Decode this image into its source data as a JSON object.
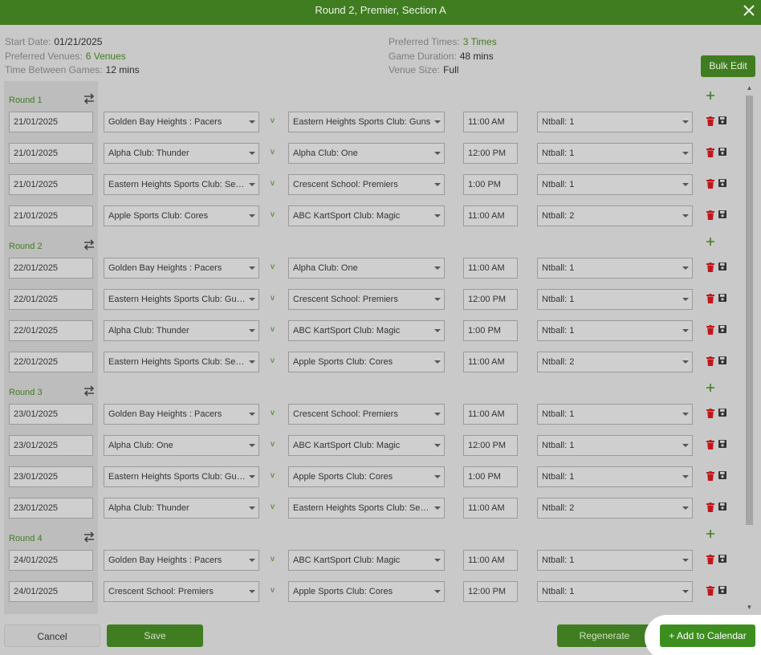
{
  "titlebar": {
    "title": "Round 2, Premier, Section A",
    "close_icon": "close-icon"
  },
  "info": {
    "start_date_label": "Start Date:",
    "start_date": "01/21/2025",
    "preferred_venues_label": "Preferred Venues:",
    "preferred_venues": "6 Venues",
    "time_between_label": "Time Between Games:",
    "time_between": "12 mins",
    "preferred_times_label": "Preferred Times:",
    "preferred_times": "3 Times",
    "game_duration_label": "Game Duration:",
    "game_duration": "48 mins",
    "venue_size_label": "Venue Size:",
    "venue_size": "Full"
  },
  "bulk_edit_label": "Bulk Edit",
  "vs_label": "v",
  "rounds": [
    {
      "label": "Round 1",
      "matches": [
        {
          "date": "21/01/2025",
          "home": "Golden Bay Heights : Pacers",
          "away": "Eastern Heights Sports Club: Guns",
          "time": "11:00 AM",
          "venue": "Ntball: 1"
        },
        {
          "date": "21/01/2025",
          "home": "Alpha Club: Thunder",
          "away": "Alpha Club: One",
          "time": "12:00 PM",
          "venue": "Ntball: 1"
        },
        {
          "date": "21/01/2025",
          "home": "Eastern Heights Sports Club: Seniors",
          "away": "Crescent School: Premiers",
          "time": "1:00 PM",
          "venue": "Ntball: 1"
        },
        {
          "date": "21/01/2025",
          "home": "Apple Sports Club: Cores",
          "away": "ABC KartSport Club: Magic",
          "time": "11:00 AM",
          "venue": "Ntball: 2"
        }
      ]
    },
    {
      "label": "Round 2",
      "matches": [
        {
          "date": "22/01/2025",
          "home": "Golden Bay Heights : Pacers",
          "away": "Alpha Club: One",
          "time": "11:00 AM",
          "venue": "Ntball: 1"
        },
        {
          "date": "22/01/2025",
          "home": "Eastern Heights Sports Club: Guns",
          "away": "Crescent School: Premiers",
          "time": "12:00 PM",
          "venue": "Ntball: 1"
        },
        {
          "date": "22/01/2025",
          "home": "Alpha Club: Thunder",
          "away": "ABC KartSport Club: Magic",
          "time": "1:00 PM",
          "venue": "Ntball: 1"
        },
        {
          "date": "22/01/2025",
          "home": "Eastern Heights Sports Club: Seniors",
          "away": "Apple Sports Club: Cores",
          "time": "11:00 AM",
          "venue": "Ntball: 2"
        }
      ]
    },
    {
      "label": "Round 3",
      "matches": [
        {
          "date": "23/01/2025",
          "home": "Golden Bay Heights : Pacers",
          "away": "Crescent School: Premiers",
          "time": "11:00 AM",
          "venue": "Ntball: 1"
        },
        {
          "date": "23/01/2025",
          "home": "Alpha Club: One",
          "away": "ABC KartSport Club: Magic",
          "time": "12:00 PM",
          "venue": "Ntball: 1"
        },
        {
          "date": "23/01/2025",
          "home": "Eastern Heights Sports Club: Guns",
          "away": "Apple Sports Club: Cores",
          "time": "1:00 PM",
          "venue": "Ntball: 1"
        },
        {
          "date": "23/01/2025",
          "home": "Alpha Club: Thunder",
          "away": "Eastern Heights Sports Club: Seniors",
          "time": "11:00 AM",
          "venue": "Ntball: 2"
        }
      ]
    },
    {
      "label": "Round 4",
      "matches": [
        {
          "date": "24/01/2025",
          "home": "Golden Bay Heights : Pacers",
          "away": "ABC KartSport Club: Magic",
          "time": "11:00 AM",
          "venue": "Ntball: 1"
        },
        {
          "date": "24/01/2025",
          "home": "Crescent School: Premiers",
          "away": "Apple Sports Club: Cores",
          "time": "12:00 PM",
          "venue": "Ntball: 1"
        }
      ]
    }
  ],
  "footer": {
    "cancel": "Cancel",
    "save": "Save",
    "regenerate": "Regenerate",
    "add_to_calendar": "+ Add to Calendar"
  },
  "colors": {
    "brand_green": "#3f7d20",
    "delete_red": "#c0181b"
  }
}
